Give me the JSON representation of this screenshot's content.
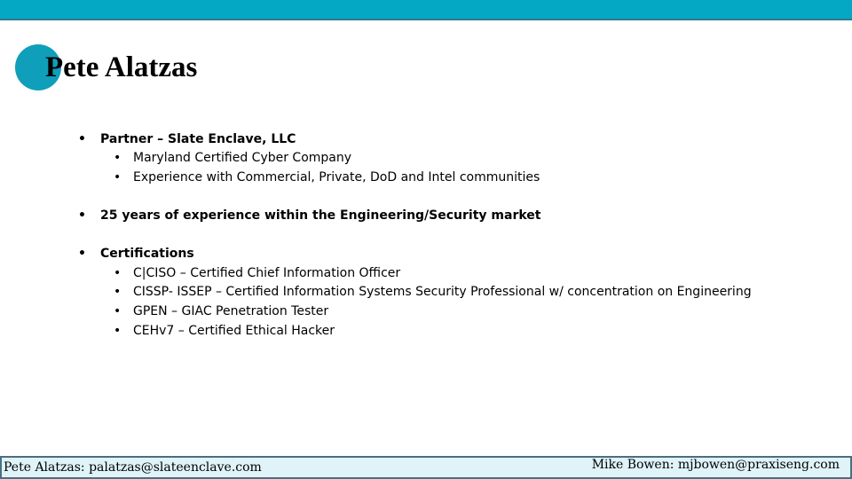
{
  "slide": {
    "title": "Pete Alatzas",
    "accent_color": "#04a8c5",
    "bullet_char": "•",
    "sections": [
      {
        "text": "Partner – Slate Enclave, LLC",
        "sub_items": [
          "Maryland Certified Cyber Company",
          "Experience with Commercial, Private, DoD and Intel communities"
        ]
      },
      {
        "text": "25 years of experience within the Engineering/Security market",
        "sub_items": []
      },
      {
        "text": "Certifications",
        "sub_items": [
          "C|CISO – Certified Chief Information Officer",
          "CISSP- ISSEP – Certified Information Systems Security Professional w/ concentration on Engineering",
          "GPEN – GIAC Penetration Tester",
          "CEHv7 – Certified Ethical Hacker"
        ]
      }
    ]
  },
  "footer": {
    "left": "Pete Alatzas: palatzas@slateenclave.com",
    "right": "Mike Bowen: mjbowen@praxiseng.com"
  }
}
